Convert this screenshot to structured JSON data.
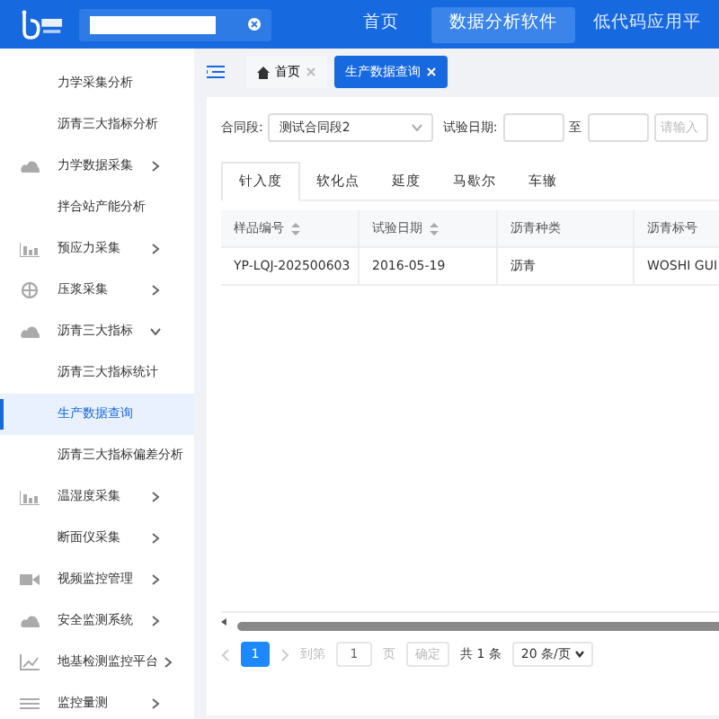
{
  "header": {
    "nav": [
      {
        "label": "首页",
        "selected": false
      },
      {
        "label": "数据分析软件",
        "selected": true
      },
      {
        "label": "低代码应用平",
        "selected": false
      }
    ]
  },
  "sidebar": {
    "items": [
      {
        "label": "力学采集分析",
        "kind": "none",
        "selected": false
      },
      {
        "label": "沥青三大指标分析",
        "kind": "none",
        "selected": false
      },
      {
        "label": "力学数据采集",
        "kind": "cloud",
        "expanded": false,
        "selected": false
      },
      {
        "label": "拌合站产能分析",
        "kind": "none",
        "selected": false
      },
      {
        "label": "预应力采集",
        "kind": "bars",
        "expanded": false,
        "selected": false
      },
      {
        "label": "压浆采集",
        "kind": "globe",
        "expanded": false,
        "selected": false
      },
      {
        "label": "沥青三大指标",
        "kind": "cloud",
        "expanded": true,
        "selected": false
      },
      {
        "label": "沥青三大指标统计",
        "kind": "none",
        "selected": false
      },
      {
        "label": "生产数据查询",
        "kind": "none",
        "selected": true
      },
      {
        "label": "沥青三大指标偏差分析",
        "kind": "none",
        "selected": false
      },
      {
        "label": "温湿度采集",
        "kind": "bars",
        "expanded": false,
        "selected": false
      },
      {
        "label": "断面仪采集",
        "kind": "none",
        "expanded": false,
        "selected": false
      },
      {
        "label": "视频监控管理",
        "kind": "video",
        "expanded": false,
        "selected": false
      },
      {
        "label": "安全监测系统",
        "kind": "cloud",
        "expanded": false,
        "selected": false
      },
      {
        "label": "地基检测监控平台",
        "kind": "chart",
        "expanded": false,
        "selected": false
      },
      {
        "label": "监控量测",
        "kind": "list",
        "expanded": false,
        "selected": false
      }
    ]
  },
  "page_tabs": [
    {
      "label": "首页",
      "kind": "home",
      "selected": false
    },
    {
      "label": "生产数据查询",
      "kind": "plain",
      "selected": true
    }
  ],
  "filter": {
    "contract_label": "合同段:",
    "contract_value": "测试合同段2",
    "date_label": "试验日期:",
    "to_label": "至",
    "end_placeholder": "请输入"
  },
  "tabs": [
    {
      "label": "针入度",
      "selected": true
    },
    {
      "label": "软化点",
      "selected": false
    },
    {
      "label": "延度",
      "selected": false
    },
    {
      "label": "马歇尔",
      "selected": false
    },
    {
      "label": "车辙",
      "selected": false
    }
  ],
  "table": {
    "columns": [
      {
        "label": "样品编号",
        "sortable": true
      },
      {
        "label": "试验日期",
        "sortable": true
      },
      {
        "label": "沥青种类",
        "sortable": false
      },
      {
        "label": "沥青标号",
        "sortable": false
      }
    ],
    "rows": [
      [
        "YP-LQJ-202500603",
        "2016-05-19",
        "沥青",
        "WOSHI GUI"
      ]
    ]
  },
  "pagination": {
    "current": "1",
    "goto_label": "到第",
    "goto_value": "1",
    "page_unit": "页",
    "confirm": "确定",
    "total": "共 1 条",
    "page_size": "20 条/页"
  }
}
